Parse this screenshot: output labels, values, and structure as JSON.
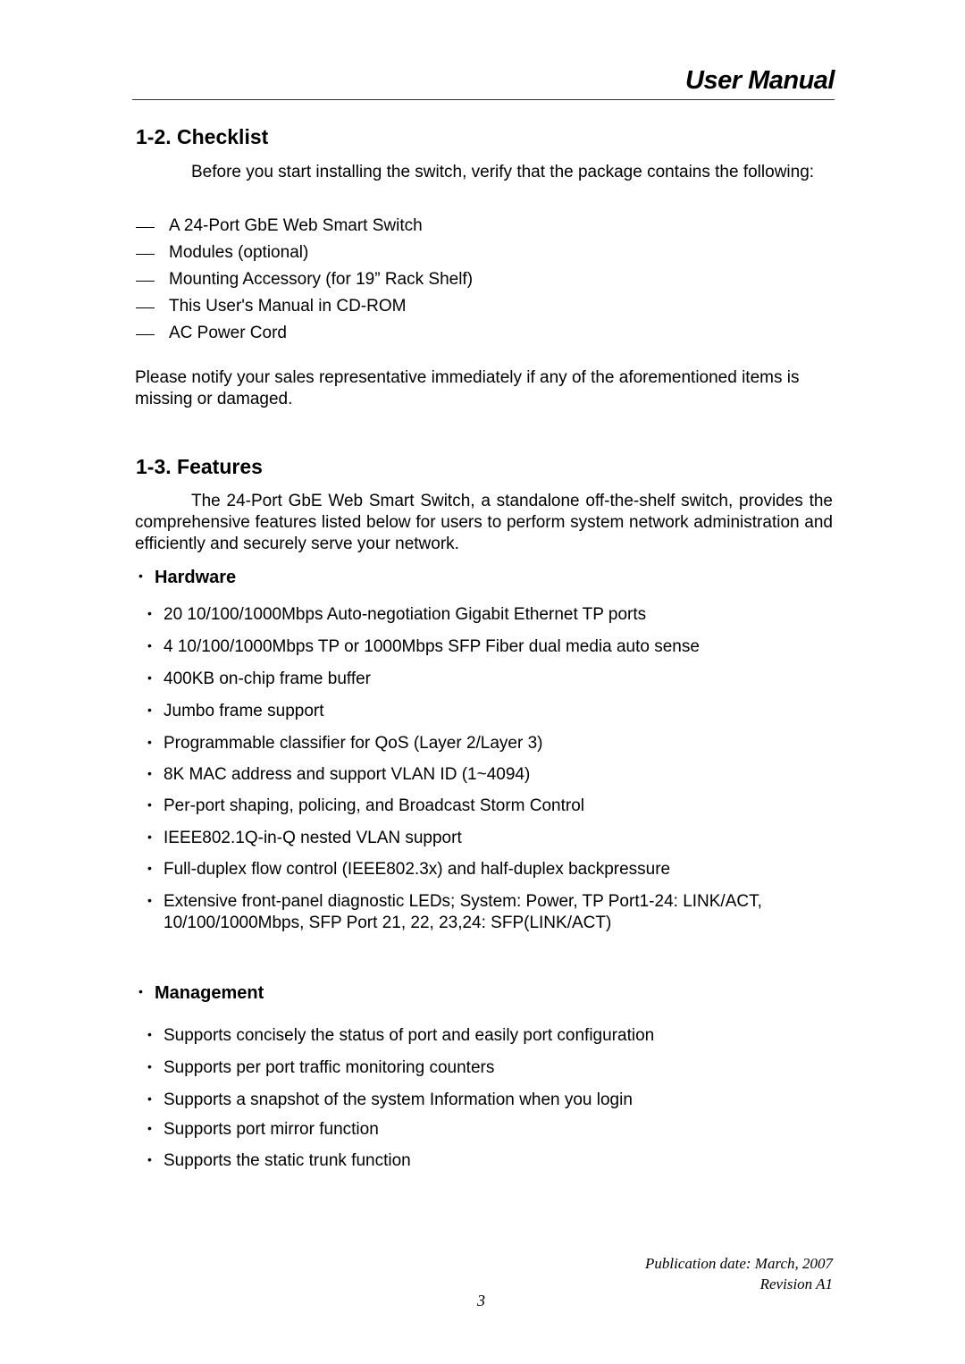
{
  "header": {
    "title": "User Manual"
  },
  "checklist": {
    "heading": "1-2. Checklist",
    "intro": "Before you start installing the switch, verify that the package contains the following:",
    "items": [
      "A 24-Port GbE Web Smart Switch",
      "Modules (optional)",
      "Mounting Accessory (for 19” Rack Shelf)",
      "This User's Manual in CD-ROM",
      "AC Power Cord"
    ],
    "notice": "Please notify your sales representative immediately if any of the aforementioned items is missing or damaged."
  },
  "features": {
    "heading": "1-3. Features",
    "intro": "The 24-Port GbE Web Smart Switch, a standalone off-the-shelf switch, provides the comprehensive features listed below for users to perform system network administration and efficiently and securely serve your network.",
    "hardware": {
      "heading": "Hardware",
      "items": [
        "20 10/100/1000Mbps Auto-negotiation Gigabit Ethernet TP ports",
        "4 10/100/1000Mbps TP or 1000Mbps SFP Fiber dual media auto sense",
        "400KB on-chip frame buffer",
        "Jumbo frame support",
        "Programmable classifier for QoS (Layer 2/Layer 3)",
        "8K MAC address and support VLAN ID (1~4094)",
        "Per-port shaping, policing, and Broadcast Storm Control",
        "IEEE802.1Q-in-Q nested VLAN support",
        "Full-duplex flow control (IEEE802.3x) and half-duplex backpressure",
        "Extensive front-panel diagnostic LEDs; System: Power, TP Port1-24:  LINK/ACT, 10/100/1000Mbps, SFP Port 21, 22, 23,24: SFP(LINK/ACT)"
      ]
    },
    "management": {
      "heading": "Management",
      "items": [
        "Supports concisely the status of port and easily port configuration",
        "Supports per port traffic monitoring counters",
        "Supports a snapshot of the system Information when you login",
        "Supports port mirror function",
        "Supports the static trunk function"
      ]
    }
  },
  "footer": {
    "publication": "Publication date: March, 2007",
    "revision": "Revision A1",
    "page_number": "3"
  },
  "bullet_glyph": "•"
}
